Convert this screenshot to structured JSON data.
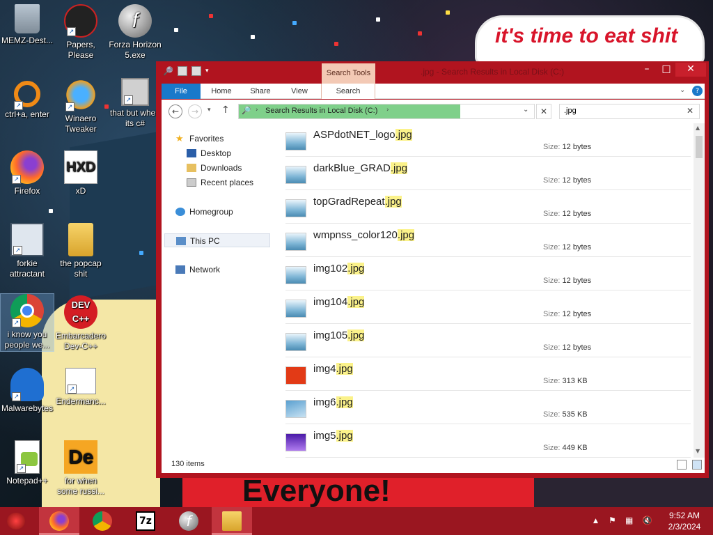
{
  "desktop": {
    "sign_text": "it's time to eat shit",
    "poster_text": "Everyone!",
    "icons": [
      {
        "label": "MEMZ-Dest..."
      },
      {
        "label": "Papers, Please"
      },
      {
        "label": "Forza Horizon 5.exe"
      },
      {
        "label": "ctrl+a, enter"
      },
      {
        "label": "Winaero Tweaker"
      },
      {
        "label": "that but when its c#"
      },
      {
        "label": "Firefox"
      },
      {
        "label": "xD"
      },
      {
        "label": "forkie attractant"
      },
      {
        "label": "the popcap shit"
      },
      {
        "label": "i know you people we..."
      },
      {
        "label": "Embarcadero Dev-C++"
      },
      {
        "label": "Malwarebytes"
      },
      {
        "label": "Endermanc..."
      },
      {
        "label": "Notepad++"
      },
      {
        "label": "for when some russi..."
      }
    ]
  },
  "window": {
    "contextual_tab": "Search Tools",
    "title": ".jpg - Search Results in Local Disk (C:)",
    "ribbon_tabs": [
      "File",
      "Home",
      "Share",
      "View",
      "Search"
    ],
    "address": "Search Results in Local Disk (C:)",
    "search_query": ".jpg",
    "nav": {
      "favorites": "Favorites",
      "desktop": "Desktop",
      "downloads": "Downloads",
      "recent": "Recent places",
      "homegroup": "Homegroup",
      "thispc": "This PC",
      "network": "Network"
    },
    "files": [
      {
        "base": "ASPdotNET_logo",
        "ext": ".jpg",
        "size_label": "Size:",
        "size": "12 bytes",
        "thumb": "blue"
      },
      {
        "base": "darkBlue_GRAD",
        "ext": ".jpg",
        "size_label": "Size:",
        "size": "12 bytes",
        "thumb": "blue"
      },
      {
        "base": "topGradRepeat",
        "ext": ".jpg",
        "size_label": "Size:",
        "size": "12 bytes",
        "thumb": "blue"
      },
      {
        "base": "wmpnss_color120",
        "ext": ".jpg",
        "size_label": "Size:",
        "size": "12 bytes",
        "thumb": "blue"
      },
      {
        "base": "img102",
        "ext": ".jpg",
        "size_label": "Size:",
        "size": "12 bytes",
        "thumb": "blue"
      },
      {
        "base": "img104",
        "ext": ".jpg",
        "size_label": "Size:",
        "size": "12 bytes",
        "thumb": "blue"
      },
      {
        "base": "img105",
        "ext": ".jpg",
        "size_label": "Size:",
        "size": "12 bytes",
        "thumb": "blue"
      },
      {
        "base": "img4",
        "ext": ".jpg",
        "size_label": "Size:",
        "size": "313 KB",
        "thumb": "red"
      },
      {
        "base": "img6",
        "ext": ".jpg",
        "size_label": "Size:",
        "size": "535 KB",
        "thumb": "sky"
      },
      {
        "base": "img5",
        "ext": ".jpg",
        "size_label": "Size:",
        "size": "449 KB",
        "thumb": "purple"
      }
    ],
    "item_count": "130 items"
  },
  "taskbar": {
    "time": "9:52 AM",
    "date": "2/3/2024"
  },
  "colors": {
    "accent": "#b1141f",
    "file_tab": "#1979ca",
    "highlight": "#fbf28a",
    "address_fill": "#7fd08a"
  }
}
